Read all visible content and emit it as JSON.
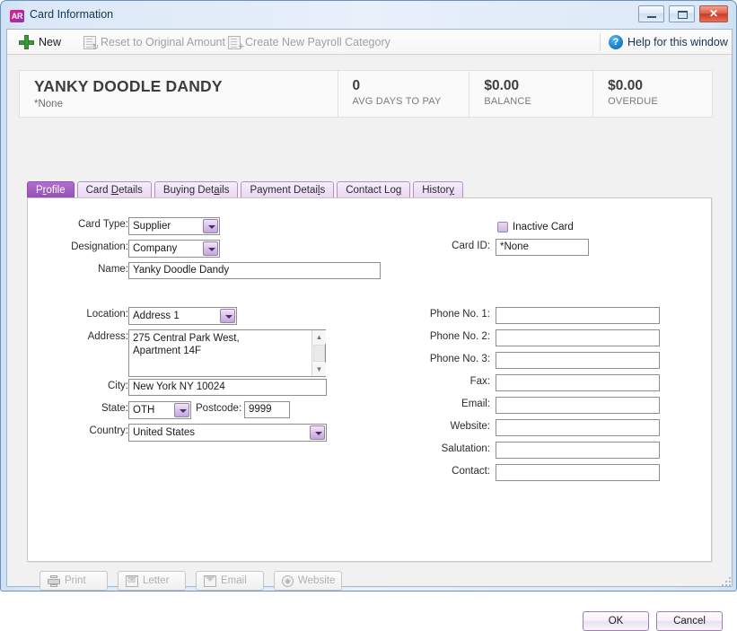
{
  "window": {
    "title": "Card Information",
    "app_badge": "AR",
    "controls": {
      "minimize": "minimize-button",
      "maximize": "maximize-button",
      "close": "✕"
    }
  },
  "toolbar": {
    "new_label": "New",
    "reset_label": "Reset to Original Amount",
    "payroll_label": "Create New Payroll Category",
    "help_label": "Help for this window",
    "help_glyph": "?"
  },
  "header": {
    "card_name": "YANKY DOODLE DANDY",
    "card_subtitle": "*None",
    "stats": [
      {
        "value": "0",
        "label": "AVG DAYS TO PAY"
      },
      {
        "value": "$0.00",
        "label": "BALANCE"
      },
      {
        "value": "$0.00",
        "label": "OVERDUE"
      }
    ]
  },
  "tabs": [
    {
      "label": "Profile",
      "pre": "P",
      "mnemonic": "r",
      "post": "ofile",
      "active": true
    },
    {
      "label": "Card Details",
      "pre": "Card ",
      "mnemonic": "D",
      "post": "etails",
      "active": false
    },
    {
      "label": "Buying Details",
      "pre": "Buying Det",
      "mnemonic": "a",
      "post": "ils",
      "active": false
    },
    {
      "label": "Payment Details",
      "pre": "Payment Detai",
      "mnemonic": "l",
      "post": "s",
      "active": false
    },
    {
      "label": "Contact Log",
      "pre": "Contact Lo",
      "mnemonic": "g",
      "post": "",
      "active": false
    },
    {
      "label": "History",
      "pre": "Histor",
      "mnemonic": "y",
      "post": "",
      "active": false
    }
  ],
  "form": {
    "card_type": {
      "label": "Card Type:",
      "value": "Supplier"
    },
    "designation": {
      "label": "Designation:",
      "value": "Company"
    },
    "name": {
      "label": "Name:",
      "value": "Yanky Doodle Dandy"
    },
    "inactive": {
      "label": "Inactive Card",
      "checked": false
    },
    "card_id": {
      "label": "Card ID:",
      "value": "*None"
    },
    "location": {
      "label": "Location:",
      "value": "Address 1"
    },
    "address": {
      "label": "Address:",
      "value": "275 Central Park West,\nApartment 14F"
    },
    "city": {
      "label": "City:",
      "value": "New York NY 10024"
    },
    "state": {
      "label": "State:",
      "value": "OTH"
    },
    "postcode": {
      "label": "Postcode:",
      "value": "9999"
    },
    "country": {
      "label": "Country:",
      "value": "United States"
    },
    "phone1": {
      "label": "Phone No. 1:",
      "value": ""
    },
    "phone2": {
      "label": "Phone No. 2:",
      "value": ""
    },
    "phone3": {
      "label": "Phone No. 3:",
      "value": ""
    },
    "fax": {
      "label": "Fax:",
      "value": ""
    },
    "email": {
      "label": "Email:",
      "value": ""
    },
    "website": {
      "label": "Website:",
      "value": ""
    },
    "salutation": {
      "label": "Salutation:",
      "value": ""
    },
    "contact": {
      "label": "Contact:",
      "value": ""
    }
  },
  "actions": [
    {
      "label": "Print",
      "icon": "printer-icon"
    },
    {
      "label": "Letter",
      "icon": "letter-icon"
    },
    {
      "label": "Email",
      "icon": "envelope-icon"
    },
    {
      "label": "Website",
      "icon": "globe-icon"
    }
  ],
  "dialog": {
    "ok_label": "OK",
    "cancel_label": "Cancel"
  },
  "scrollbar": {
    "up": "▲",
    "down": "▼"
  },
  "colors": {
    "accent_purple": "#9450b8",
    "title_blue": "#17334d",
    "close_red": "#cc3a26",
    "plus_green": "#3a9a3a",
    "help_blue": "#1f87d0"
  }
}
